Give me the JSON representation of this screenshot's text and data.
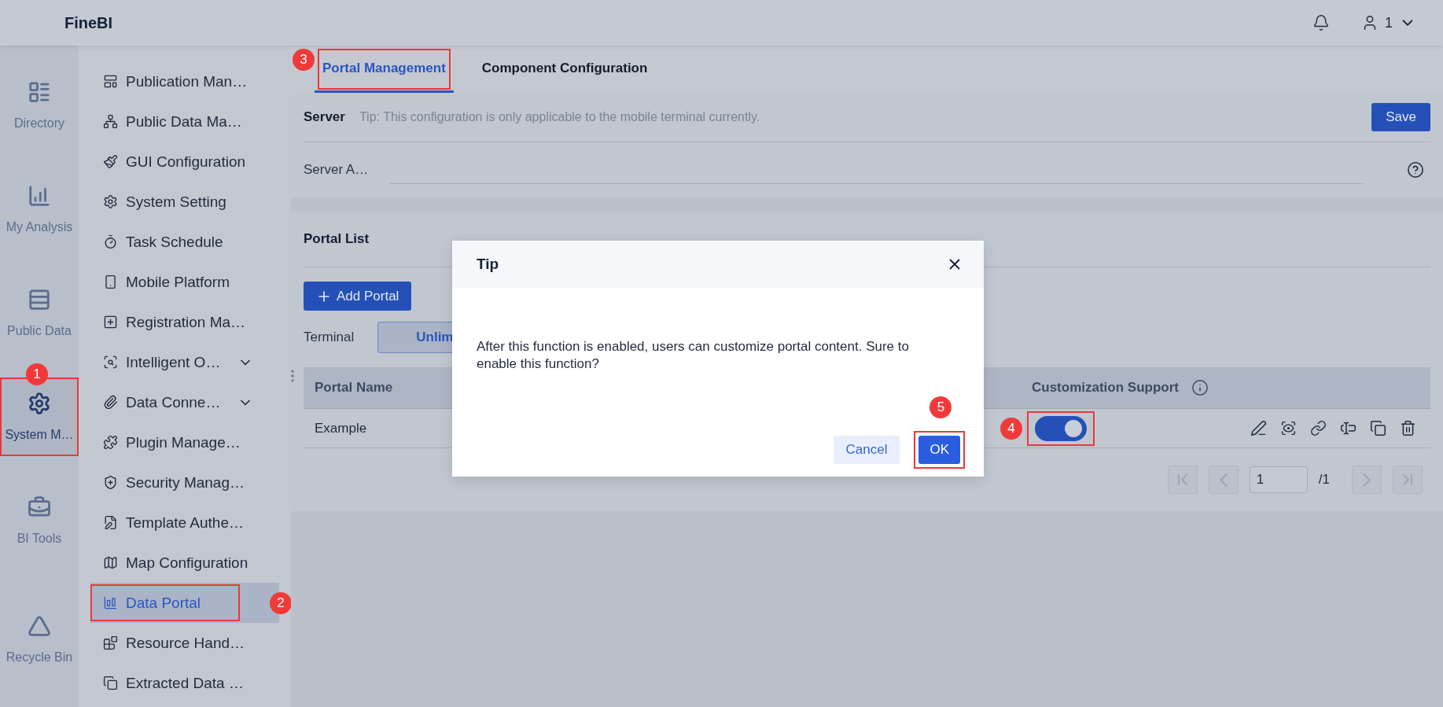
{
  "app": {
    "title": "FineBI",
    "user": "1"
  },
  "rail": [
    {
      "label": "Directory",
      "selected": false,
      "highlighted": false
    },
    {
      "label": "My Analysis",
      "selected": false,
      "highlighted": false
    },
    {
      "label": "Public Data",
      "selected": false,
      "highlighted": false
    },
    {
      "label": "System M…",
      "selected": true,
      "highlighted": true,
      "marker": "1"
    },
    {
      "label": "BI Tools",
      "selected": false,
      "highlighted": false
    },
    {
      "label": "Recycle Bin",
      "selected": false,
      "highlighted": false
    }
  ],
  "sidebar": {
    "items": [
      {
        "label": "Publication Man…",
        "kind": "page",
        "selected": false,
        "highlighted": false
      },
      {
        "label": "Public Data Ma…",
        "kind": "page",
        "selected": false,
        "highlighted": false
      },
      {
        "label": "GUI Configuration",
        "kind": "page",
        "selected": false,
        "highlighted": false
      },
      {
        "label": "System Setting",
        "kind": "page",
        "selected": false,
        "highlighted": false
      },
      {
        "label": "Task Schedule",
        "kind": "page",
        "selected": false,
        "highlighted": false
      },
      {
        "label": "Mobile Platform",
        "kind": "page",
        "selected": false,
        "highlighted": false
      },
      {
        "label": "Registration Ma…",
        "kind": "page",
        "selected": false,
        "highlighted": false
      },
      {
        "label": "Intelligent O…",
        "kind": "group",
        "selected": false,
        "highlighted": false
      },
      {
        "label": "Data Conne…",
        "kind": "group",
        "selected": false,
        "highlighted": false
      },
      {
        "label": "Plugin Manage…",
        "kind": "page",
        "selected": false,
        "highlighted": false
      },
      {
        "label": "Security Manag…",
        "kind": "page",
        "selected": false,
        "highlighted": false
      },
      {
        "label": "Template Authe…",
        "kind": "page",
        "selected": false,
        "highlighted": false
      },
      {
        "label": "Map Configuration",
        "kind": "page",
        "selected": false,
        "highlighted": false
      },
      {
        "label": "Data Portal",
        "kind": "page",
        "selected": true,
        "highlighted": true,
        "marker": "2"
      },
      {
        "label": "Resource Hand…",
        "kind": "page",
        "selected": false,
        "highlighted": false
      },
      {
        "label": "Extracted Data …",
        "kind": "page",
        "selected": false,
        "highlighted": false
      }
    ]
  },
  "tabs": [
    {
      "label": "Portal Management",
      "selected": true,
      "highlighted": true,
      "marker": "3"
    },
    {
      "label": "Component Configuration",
      "selected": false,
      "highlighted": false
    }
  ],
  "server": {
    "title": "Server",
    "tip": "Tip: This configuration is only applicable to the mobile terminal currently.",
    "save": "Save",
    "field_label": "Server A…"
  },
  "portal_list": {
    "title": "Portal List",
    "add_button": "Add Portal",
    "terminal_label": "Terminal",
    "terminal_option": "Unlim",
    "columns": [
      "Portal Name",
      "Customization Support"
    ],
    "rows": [
      {
        "name": "Example",
        "customization": true,
        "highlighted": true,
        "marker": "4"
      }
    ],
    "pagination": {
      "page": "1",
      "total": "/1"
    }
  },
  "dialog": {
    "title": "Tip",
    "message": "After this function is enabled, users can customize portal content. Sure to enable this function?",
    "cancel": "Cancel",
    "ok": "OK",
    "ok_highlighted": true,
    "ok_marker": "5"
  }
}
